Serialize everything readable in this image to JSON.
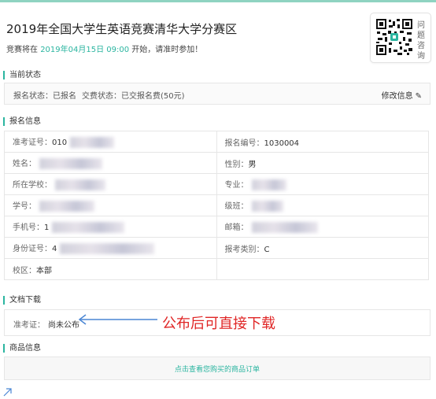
{
  "header": {
    "title": "2019年全国大学生英语竞赛清华大学分赛区",
    "subtitle_prefix": "竞赛将在",
    "subtitle_date": "2019年04月15日 09:00",
    "subtitle_suffix": "开始，请准时参加！"
  },
  "qr_card": {
    "label": "问题咨询"
  },
  "current_status": {
    "section_title": "当前状态",
    "registration_status": "报名状态：已报名",
    "payment_status": "交费状态：已交报名费(50元)",
    "edit_label": "修改信息"
  },
  "registration_info": {
    "section_title": "报名信息",
    "rows": [
      [
        {
          "label": "准考证号：",
          "value": "010"
        },
        {
          "label": "报名编号：",
          "value": "1030004"
        }
      ],
      [
        {
          "label": "姓名：",
          "value": ""
        },
        {
          "label": "性别：",
          "value": "男"
        }
      ],
      [
        {
          "label": "所在学校：",
          "value": ""
        },
        {
          "label": "专业：",
          "value": ""
        }
      ],
      [
        {
          "label": "学号：",
          "value": ""
        },
        {
          "label": "级班：",
          "value": ""
        }
      ],
      [
        {
          "label": "手机号：",
          "value": "1"
        },
        {
          "label": "邮箱：",
          "value": ""
        }
      ],
      [
        {
          "label": "身份证号：",
          "value": "4"
        },
        {
          "label": "报考类别：",
          "value": "C"
        }
      ],
      [
        {
          "label": "校区：",
          "value": "本部"
        },
        {
          "label": "",
          "value": ""
        }
      ]
    ]
  },
  "documents": {
    "section_title": "文档下载",
    "ticket_label": "准考证：",
    "ticket_value": "尚未公布"
  },
  "annotation": {
    "text": "公布后可直接下载",
    "color": "#e02626"
  },
  "goods": {
    "section_title": "商品信息",
    "link_text": "点击查看您购买的商品订单"
  },
  "colors": {
    "accent": "#2bb5a0",
    "annotation": "#e02626"
  },
  "icons": {
    "edit": "pencil-icon",
    "qr": "qr-code-icon",
    "annotation": "arrow-left-icon",
    "corner": "arrow-up-right-icon"
  }
}
